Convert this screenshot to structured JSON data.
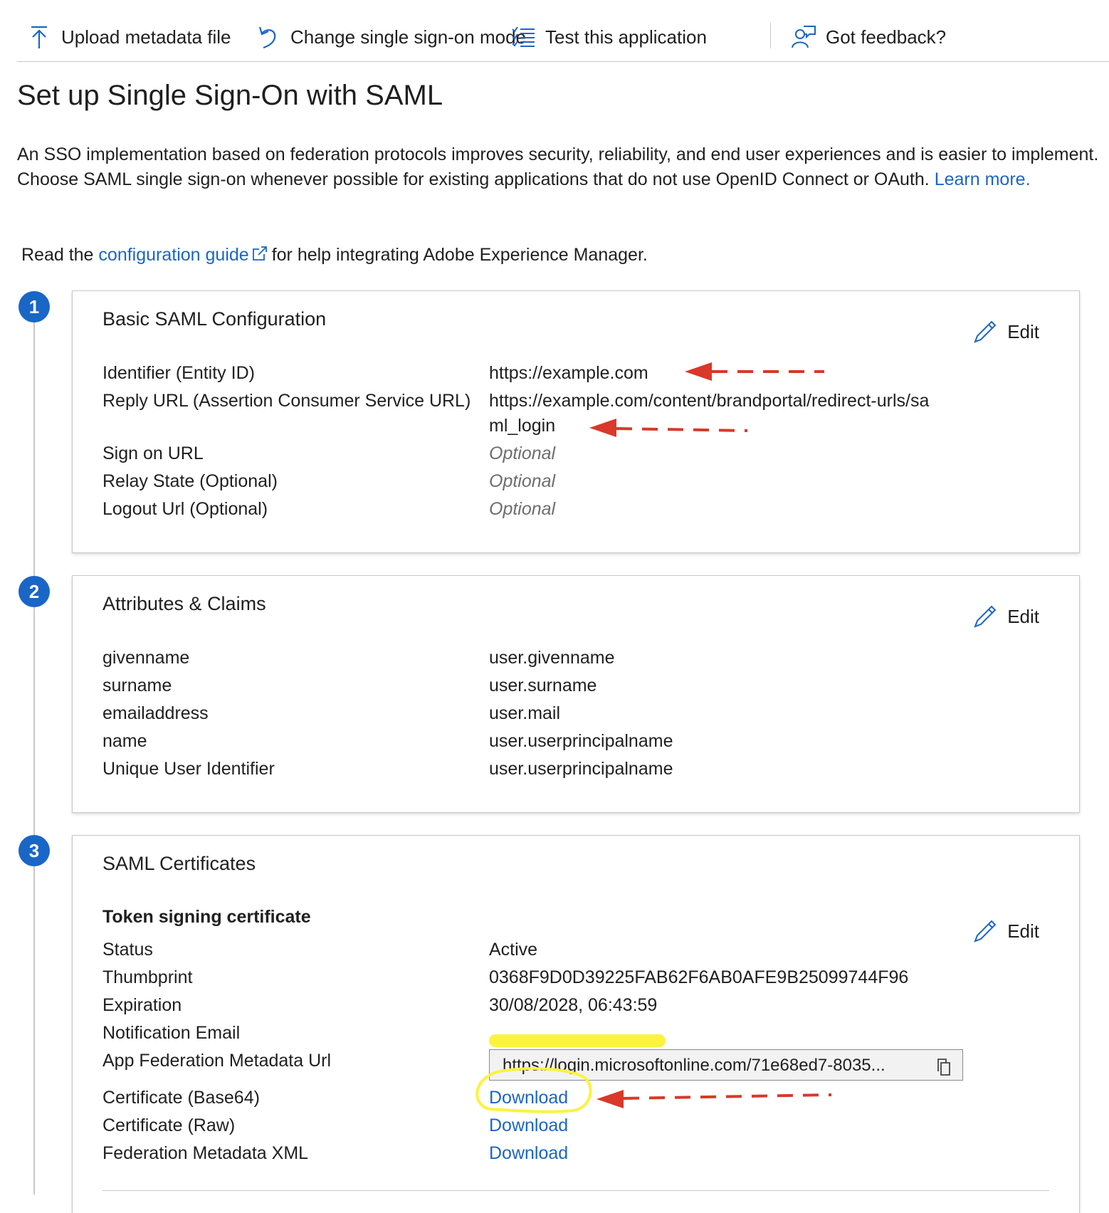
{
  "toolbar": {
    "upload_label": "Upload metadata file",
    "change_mode_label": "Change single sign-on mode",
    "test_label": "Test this application",
    "feedback_label": "Got feedback?"
  },
  "page": {
    "title": "Set up Single Sign-On with SAML",
    "intro_text": "An SSO implementation based on federation protocols improves security, reliability, and end user experiences and is easier to implement. Choose SAML single sign-on whenever possible for existing applications that do not use OpenID Connect or OAuth.",
    "learn_more": "Learn more.",
    "guide_prefix": "Read the",
    "guide_link": "configuration guide",
    "guide_suffix": "for help integrating Adobe Experience Manager."
  },
  "steps": [
    "1",
    "2",
    "3"
  ],
  "edit_label": "Edit",
  "basic": {
    "title": "Basic SAML Configuration",
    "identifier_label": "Identifier (Entity ID)",
    "identifier_value": "https://example.com",
    "reply_label": "Reply URL (Assertion Consumer Service URL)",
    "reply_value_line1": "https://example.com/content/brandportal/redirect-urls/sa",
    "reply_value_line2": "ml_login",
    "signon_label": "Sign on URL",
    "signon_value": "Optional",
    "relay_label": "Relay State (Optional)",
    "relay_value": "Optional",
    "logout_label": "Logout Url (Optional)",
    "logout_value": "Optional"
  },
  "claims": {
    "title": "Attributes & Claims",
    "rows": [
      {
        "label": "givenname",
        "value": "user.givenname"
      },
      {
        "label": "surname",
        "value": "user.surname"
      },
      {
        "label": "emailaddress",
        "value": "user.mail"
      },
      {
        "label": "name",
        "value": "user.userprincipalname"
      },
      {
        "label": "Unique User Identifier",
        "value": "user.userprincipalname"
      }
    ]
  },
  "certs": {
    "title": "SAML Certificates",
    "subtitle": "Token signing certificate",
    "status_label": "Status",
    "status_value": "Active",
    "thumbprint_label": "Thumbprint",
    "thumbprint_value": "0368F9D0D39225FAB62F6AB0AFE9B25099744F96",
    "expiration_label": "Expiration",
    "expiration_value": "30/08/2028, 06:43:59",
    "email_label": "Notification Email",
    "metadata_url_label": "App Federation Metadata Url",
    "metadata_url_value": "https://login.microsoftonline.com/71e68ed7-8035...",
    "base64_label": "Certificate (Base64)",
    "raw_label": "Certificate (Raw)",
    "fedxml_label": "Federation Metadata XML",
    "download_label": "Download"
  },
  "colors": {
    "accent": "#1a66c6",
    "annotation_arrow": "#d9382a",
    "highlight": "#fbf33f"
  },
  "icons": [
    "upload-icon",
    "undo-icon",
    "list-icon",
    "feedback-icon",
    "external-link-icon",
    "pencil-icon",
    "copy-icon"
  ]
}
